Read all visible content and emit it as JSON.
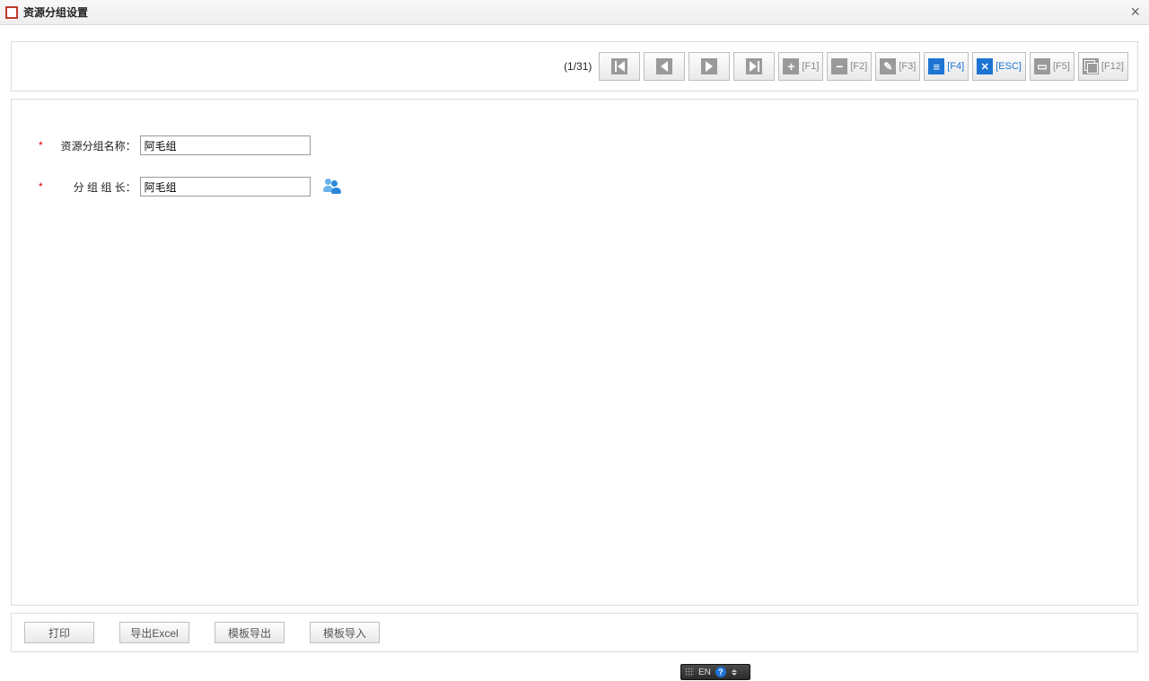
{
  "window": {
    "title": "资源分组设置"
  },
  "toolbar": {
    "counter": "(1/31)",
    "buttons": {
      "first": "",
      "prev": "",
      "next": "",
      "last": "",
      "add": "[F1]",
      "remove": "[F2]",
      "edit": "[F3]",
      "save": "[F4]",
      "cancel": "[ESC]",
      "list": "[F5]",
      "export": "[F12]"
    }
  },
  "form": {
    "name_label": "资源分组名称：",
    "name_value": "阿毛组",
    "leader_label": "分 组   组 长：",
    "leader_value": "阿毛组"
  },
  "footer": {
    "print": "打印",
    "export_excel": "导出Excel",
    "template_export": "模板导出",
    "template_import": "模板导入"
  },
  "ime": {
    "lang": "EN"
  }
}
